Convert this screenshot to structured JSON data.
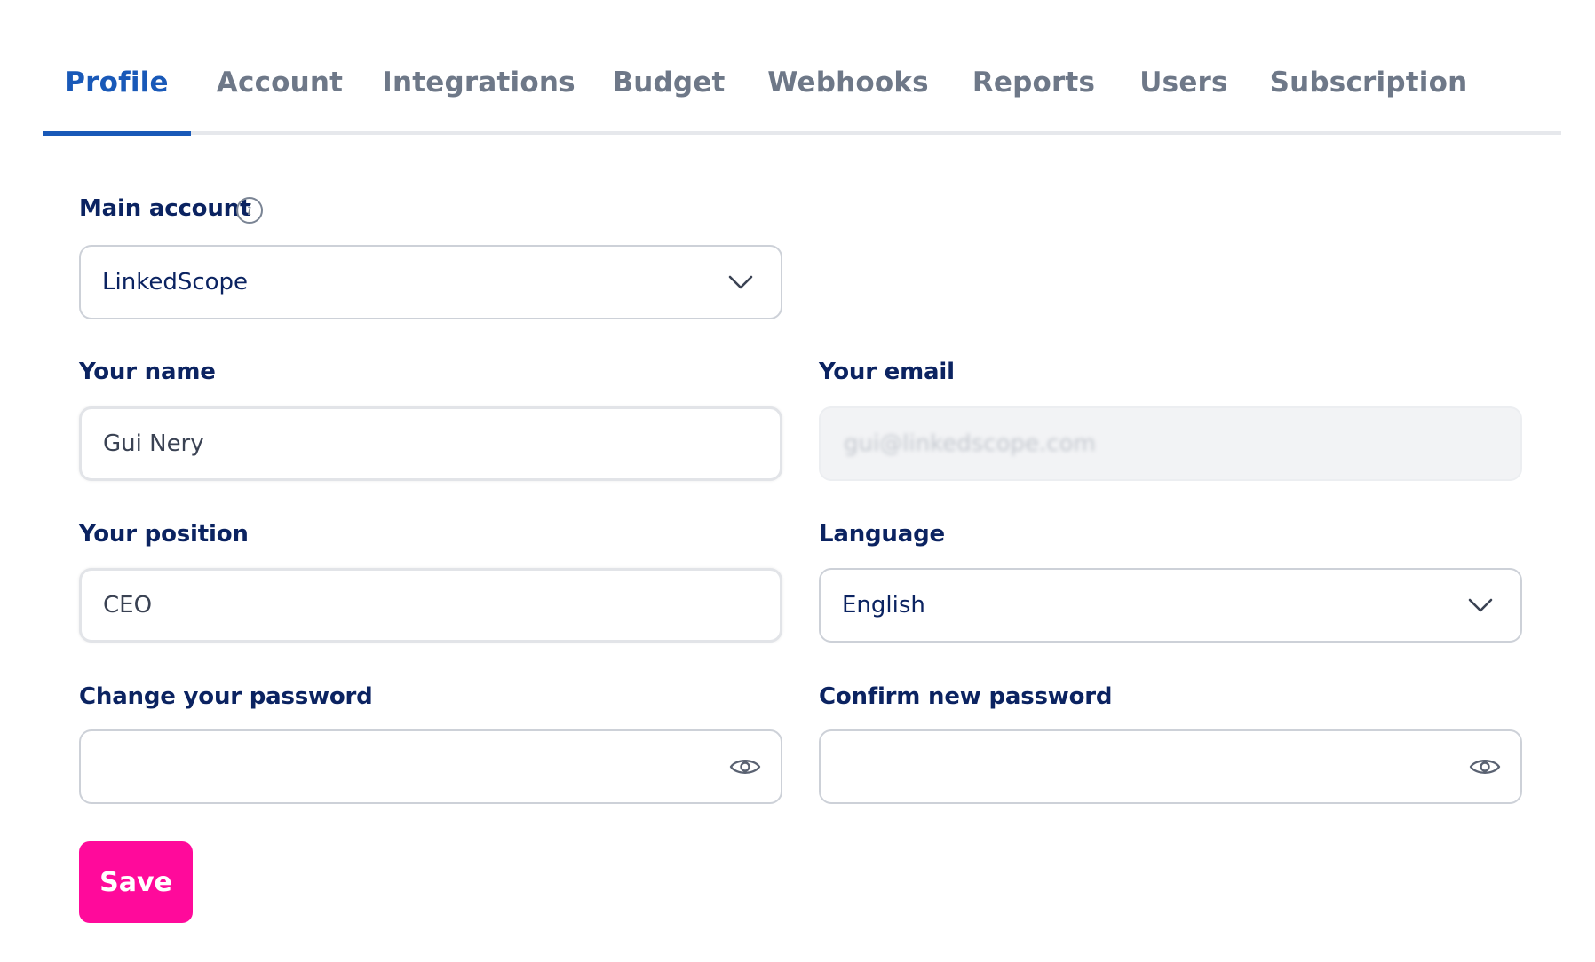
{
  "tabs": [
    {
      "label": "Profile",
      "active": true
    },
    {
      "label": "Account",
      "active": false
    },
    {
      "label": "Integrations",
      "active": false
    },
    {
      "label": "Budget",
      "active": false
    },
    {
      "label": "Webhooks",
      "active": false
    },
    {
      "label": "Reports",
      "active": false
    },
    {
      "label": "Users",
      "active": false
    },
    {
      "label": "Subscription",
      "active": false
    }
  ],
  "form": {
    "main_account": {
      "label": "Main account",
      "value": "LinkedScope"
    },
    "name": {
      "label": "Your name",
      "value": "Gui Nery"
    },
    "email": {
      "label": "Your email",
      "value": "gui@linkedscope.com"
    },
    "position": {
      "label": "Your position",
      "value": "CEO"
    },
    "language": {
      "label": "Language",
      "value": "English"
    },
    "password": {
      "label": "Change your password",
      "value": ""
    },
    "confirm_password": {
      "label": "Confirm new password",
      "value": ""
    },
    "save_label": "Save"
  },
  "colors": {
    "accent": "#1959b8",
    "heading": "#0b2361",
    "save": "#ff0a9b",
    "tab_inactive": "#6e7888"
  },
  "icons": {
    "info": "info-icon",
    "chevron": "chevron-down-icon",
    "eye": "eye-icon"
  }
}
